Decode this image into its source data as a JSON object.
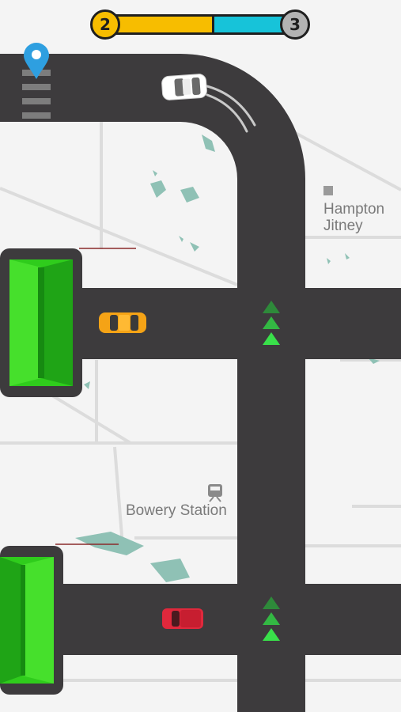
{
  "hud": {
    "current_level": "2",
    "next_level": "3",
    "progress": 0.56,
    "progress_color": "#f7bd00",
    "remaining_color": "#17c3d9"
  },
  "map": {
    "labels": {
      "hampton_line1": "Hampton",
      "hampton_line2": "Jitney",
      "bowery_station": "Bowery Station"
    }
  },
  "vehicles": {
    "player_car_color": "#ffffff",
    "orange_car_color": "#f5a316",
    "red_car_color": "#e0283c"
  },
  "colors": {
    "road": "#3d3b3d",
    "garage": "#2fcc1c",
    "arrow": "#39d94a",
    "pin": "#2e9fe0",
    "map_background": "#f4f4f4"
  },
  "icons": {
    "destination_pin": "map-pin-icon",
    "station": "train-icon",
    "bus_stop": "bus-stop-icon",
    "direction_arrows": "triangle-up-icon"
  }
}
